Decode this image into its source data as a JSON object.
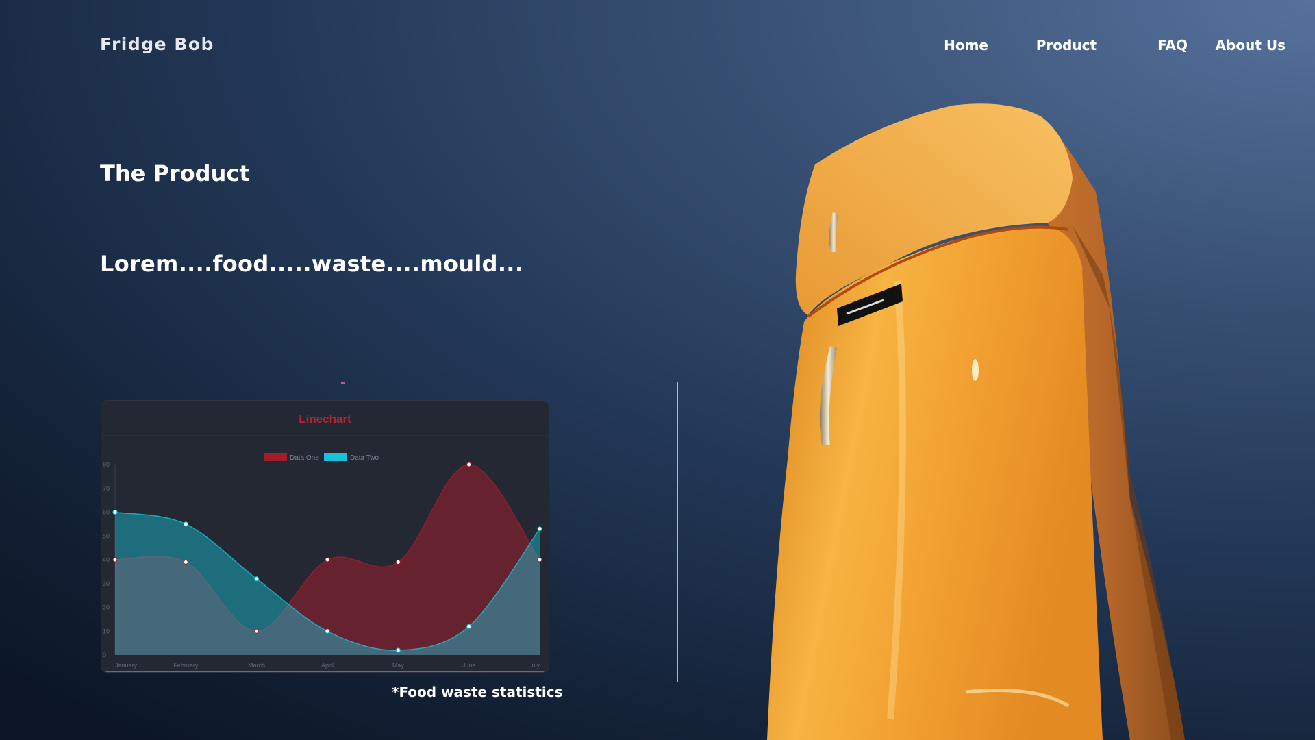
{
  "brand": {
    "name": "Fridge Bob"
  },
  "nav": {
    "items": [
      "Home",
      "Product",
      "FAQ",
      "About Us"
    ]
  },
  "hero": {
    "title": "The Product",
    "lead": "Lorem....food.....waste....mould..."
  },
  "caption": "*Food waste statistics",
  "colors": {
    "accent_red": "#a11d2b",
    "accent_cyan": "#18c0d8",
    "fridge_orange": "#f0a030",
    "chart_title": "#b52430"
  },
  "chart_data": {
    "type": "area",
    "title": "Linechart",
    "categories": [
      "January",
      "February",
      "March",
      "April",
      "May",
      "June",
      "July"
    ],
    "series": [
      {
        "name": "Data One",
        "values": [
          40,
          39,
          10,
          40,
          39,
          80,
          40
        ],
        "color": "#a11d2b"
      },
      {
        "name": "Data Two",
        "values": [
          60,
          55,
          32,
          10,
          2,
          12,
          53
        ],
        "color": "#18c0d8"
      }
    ],
    "ylim": [
      0,
      80
    ],
    "yticks": [
      0,
      10,
      20,
      30,
      40,
      50,
      60,
      70,
      80
    ],
    "legend": "top",
    "grid": false
  }
}
